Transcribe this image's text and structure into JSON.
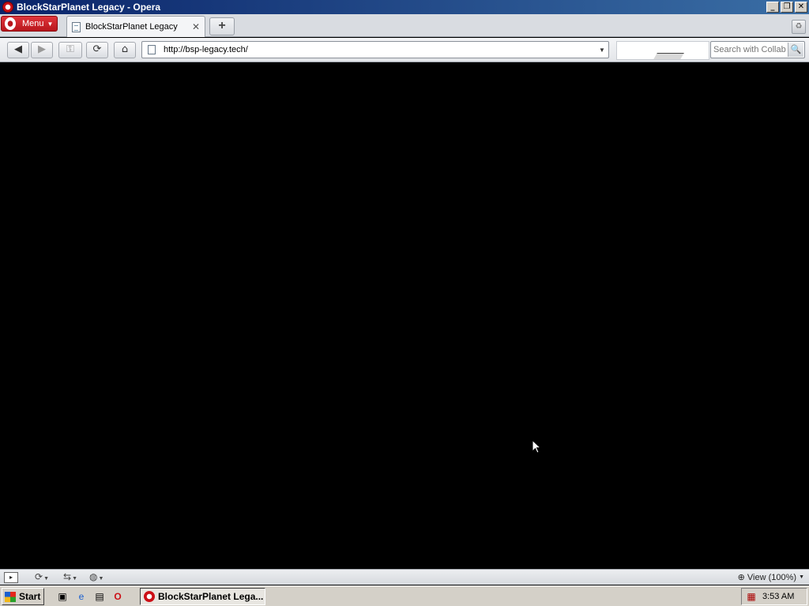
{
  "window": {
    "title": "BlockStarPlanet Legacy - Opera",
    "buttons": {
      "minimize": "_",
      "restore": "❐",
      "close": "✕"
    }
  },
  "tabbar": {
    "menu_label": "Menu",
    "tabs": [
      {
        "label": "BlockStarPlanet Legacy",
        "close": "✕"
      }
    ],
    "new_tab": "+"
  },
  "navbar": {
    "back": "◀",
    "forward": "▶",
    "key": "⚿",
    "reload": "⟳",
    "home": "⌂",
    "address": "http://bsp-legacy.tech/",
    "address_dropdown": "▼",
    "search_placeholder": "Search with Collab",
    "search_button": "🔍"
  },
  "statusbar": {
    "zoom_label": "View (100%)"
  },
  "taskbar": {
    "start_label": "Start",
    "task_label": "BlockStarPlanet Lega...",
    "clock": "3:53 AM"
  },
  "icons": {
    "app": "opera-icon",
    "page": "page-icon",
    "trash": "trash-icon",
    "zoom": "magnifier-icon"
  },
  "colors": {
    "title_bar": "#0a246a",
    "opera_red": "#cc0f16",
    "content_bg": "#000000"
  }
}
